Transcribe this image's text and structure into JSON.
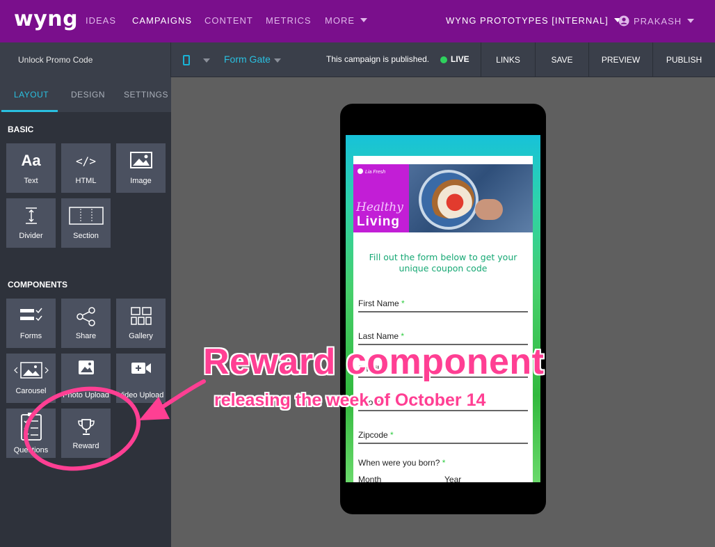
{
  "brand": "wyng",
  "nav": {
    "items": [
      "IDEAS",
      "CAMPAIGNS",
      "CONTENT",
      "METRICS",
      "MORE"
    ],
    "org": "WYNG PROTOTYPES [INTERNAL]",
    "user": "PRAKASH"
  },
  "subbar": {
    "campaign_name": "Unlock Promo Code",
    "view": "Form Gate",
    "status_text": "This campaign is published.",
    "live_label": "LIVE",
    "buttons": [
      "LINKS",
      "SAVE",
      "PREVIEW",
      "PUBLISH"
    ]
  },
  "sidebar": {
    "tabs": [
      "LAYOUT",
      "DESIGN",
      "SETTINGS"
    ],
    "active_tab": "LAYOUT",
    "basic_heading": "BASIC",
    "basic": [
      {
        "label": "Text",
        "icon": "text-icon"
      },
      {
        "label": "HTML",
        "icon": "code-icon"
      },
      {
        "label": "Image",
        "icon": "image-icon"
      },
      {
        "label": "Divider",
        "icon": "divider-icon"
      },
      {
        "label": "Section",
        "icon": "section-icon"
      }
    ],
    "components_heading": "COMPONENTS",
    "components": [
      {
        "label": "Forms",
        "icon": "forms-icon"
      },
      {
        "label": "Share",
        "icon": "share-icon"
      },
      {
        "label": "Gallery",
        "icon": "gallery-icon"
      },
      {
        "label": "Carousel",
        "icon": "carousel-icon"
      },
      {
        "label": "Photo Upload",
        "icon": "photo-upload-icon"
      },
      {
        "label": "Video Upload",
        "icon": "video-upload-icon"
      },
      {
        "label": "Questions",
        "icon": "questions-icon"
      },
      {
        "label": "Reward",
        "icon": "trophy-icon"
      }
    ]
  },
  "preview": {
    "hero_tag": "Lia Fresh",
    "hero_line1": "Healthy",
    "hero_line2": "Living",
    "intro": "Fill out the form below to get your unique coupon code",
    "fields": [
      "First Name",
      "Last Name",
      "Email",
      "Phone",
      "Zipcode"
    ],
    "birth_label": "When were you born?",
    "birth_month": "Month",
    "birth_year": "Year",
    "required_mark": "*"
  },
  "annotation": {
    "title": "Reward component",
    "subtitle": "releasing the week of October 14",
    "color": "#ff3f93"
  },
  "colors": {
    "nav_bg": "#7a0f8c",
    "accent": "#2ac0e0",
    "live": "#2ed15d",
    "sidebar_bg": "#2e323b",
    "tile_bg": "#4b5160"
  }
}
